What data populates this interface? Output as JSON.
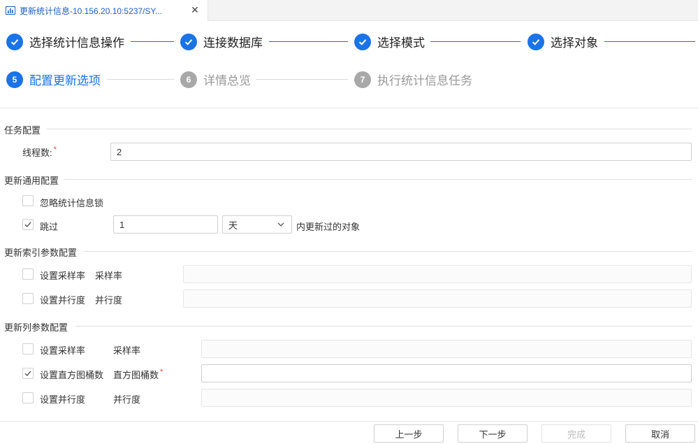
{
  "tab": {
    "title": "更新统计信息-10.156.20.10:5237/SY...",
    "close": "✕"
  },
  "steps": [
    {
      "number": "",
      "label": "选择统计信息操作",
      "state": "done"
    },
    {
      "number": "",
      "label": "连接数据库",
      "state": "done"
    },
    {
      "number": "",
      "label": "选择模式",
      "state": "done"
    },
    {
      "number": "",
      "label": "选择对象",
      "state": "done"
    },
    {
      "number": "5",
      "label": "配置更新选项",
      "state": "current"
    },
    {
      "number": "6",
      "label": "详情总览",
      "state": "pending"
    },
    {
      "number": "7",
      "label": "执行统计信息任务",
      "state": "pending"
    }
  ],
  "sections": {
    "task": {
      "title": "任务配置",
      "threads_label": "线程数:",
      "threads_value": "2",
      "required_mark": "*"
    },
    "general": {
      "title": "更新通用配置",
      "ignore_lock_label": "忽略统计信息锁",
      "ignore_lock_checked": false,
      "skip_label": "跳过",
      "skip_checked": true,
      "skip_value": "1",
      "skip_unit": "天",
      "skip_suffix": "内更新过的对象"
    },
    "index": {
      "title": "更新索引参数配置",
      "sample_checkbox_label": "设置采样率",
      "sample_field_label": "采样率",
      "parallel_checkbox_label": "设置并行度",
      "parallel_field_label": "并行度"
    },
    "column": {
      "title": "更新列参数配置",
      "sample_checkbox_label": "设置采样率",
      "sample_field_label": "采样率",
      "histogram_checkbox_label": "设置直方图桶数",
      "histogram_checked": true,
      "histogram_field_label": "直方图桶数",
      "required_mark": "*",
      "parallel_checkbox_label": "设置并行度",
      "parallel_field_label": "并行度"
    }
  },
  "footer": {
    "prev": "上一步",
    "next": "下一步",
    "finish": "完成",
    "cancel": "取消"
  },
  "colors": {
    "accent": "#1a73e8",
    "pending": "#a8a8a8"
  }
}
